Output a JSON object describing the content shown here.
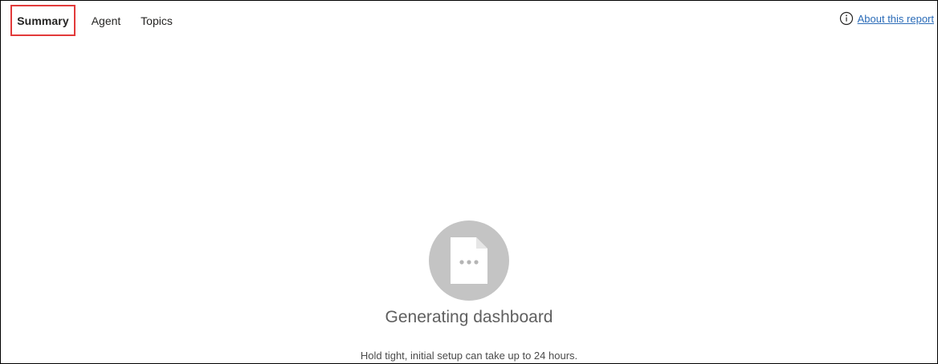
{
  "tabs": {
    "summary": "Summary",
    "agent": "Agent",
    "topics": "Topics"
  },
  "about": {
    "label": "About this report",
    "icon": "info-icon"
  },
  "loading": {
    "icon": "document-loading-icon",
    "title": "Generating dashboard",
    "message": "Hold tight, initial setup can take up to 24 hours."
  },
  "colors": {
    "selected_tab_outline": "#e23a3a",
    "link": "#2b6cb8",
    "icon_circle": "#c4c4c4"
  }
}
